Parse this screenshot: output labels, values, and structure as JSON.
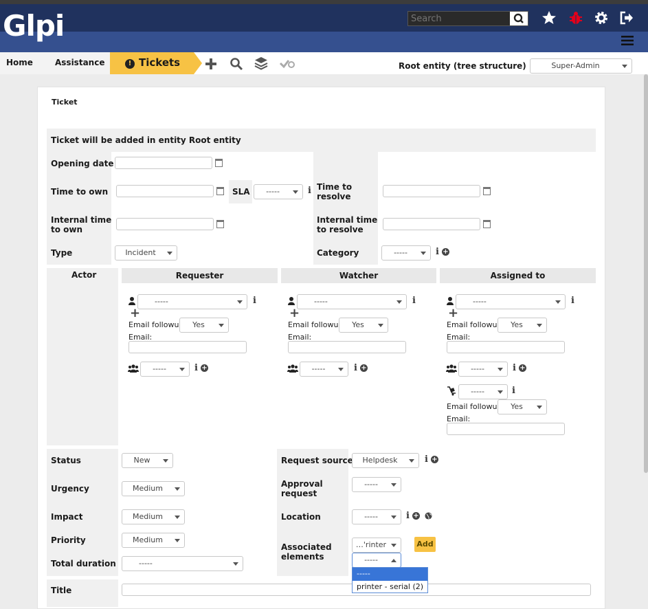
{
  "header": {
    "logo": "Glpi",
    "search_placeholder": "Search",
    "icons": [
      "search-icon",
      "star-icon",
      "bug-icon",
      "gear-icon",
      "logout-icon",
      "hamburger-icon"
    ]
  },
  "breadcrumb": {
    "home": "Home",
    "assistance": "Assistance",
    "tickets": "Tickets"
  },
  "entity": {
    "label": "Root entity (tree structure)",
    "profile": "Super-Admin"
  },
  "card": {
    "title": "Ticket",
    "entity_notice": "Ticket will be added in entity Root entity"
  },
  "form": {
    "opening_date": "Opening date",
    "time_to_own": "Time to own",
    "sla": "SLA",
    "sla_value": "-----",
    "time_to_resolve_1": "Time to",
    "time_to_resolve_2": "resolve",
    "internal_tto_1": "Internal time",
    "internal_tto_2": "to own",
    "internal_ttr_1": "Internal time",
    "internal_ttr_2": "to resolve",
    "type": "Type",
    "type_value": "Incident",
    "category": "Category",
    "category_value": "-----"
  },
  "actors": {
    "label": "Actor",
    "requester": "Requester",
    "watcher": "Watcher",
    "assigned": "Assigned to",
    "dash": "-----",
    "email_followup": "Email followup",
    "yes": "Yes",
    "email": "Email:"
  },
  "details": {
    "status": "Status",
    "status_value": "New",
    "urgency": "Urgency",
    "urgency_value": "Medium",
    "impact": "Impact",
    "impact_value": "Medium",
    "priority": "Priority",
    "priority_value": "Medium",
    "total_duration": "Total duration",
    "total_duration_value": "-----",
    "request_source": "Request source",
    "request_source_value": "Helpdesk",
    "approval_1": "Approval",
    "approval_2": "request",
    "approval_value": "-----",
    "location": "Location",
    "location_value": "-----",
    "assoc_1": "Associated",
    "assoc_2": "elements",
    "assoc_type_value": "…'rinter",
    "assoc_item_value": "-----",
    "add": "Add",
    "title": "Title"
  },
  "dropdown": {
    "options": [
      "-----",
      "printer - serial (2)"
    ]
  }
}
